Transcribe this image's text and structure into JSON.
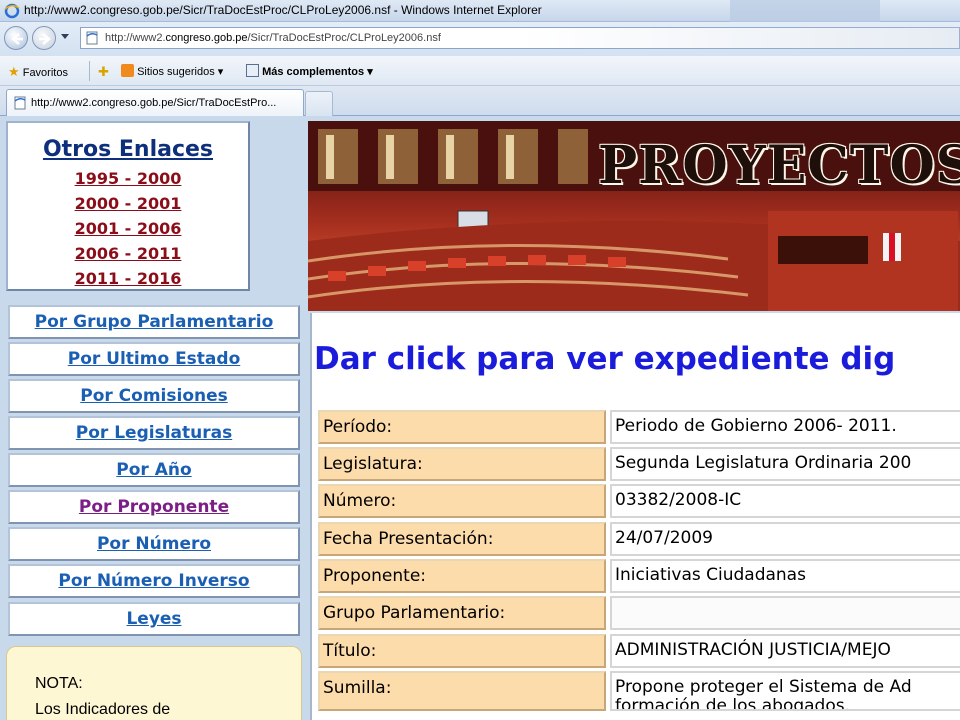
{
  "window": {
    "title": "http://www2.congreso.gob.pe/Sicr/TraDocEstProc/CLProLey2006.nsf - Windows Internet Explorer"
  },
  "address_bar": {
    "url_prefix": "http://www2.",
    "url_domain": "congreso.gob.pe",
    "url_path": "/Sicr/TraDocEstProc/CLProLey2006.nsf"
  },
  "favorites_bar": {
    "favoritos_label": "Favoritos",
    "sitios_label": "Sitios sugeridos",
    "complementos_label": "Más complementos"
  },
  "tabs": [
    {
      "label": "http://www2.congreso.gob.pe/Sicr/TraDocEstPro..."
    }
  ],
  "sidebar": {
    "otros_title": "Otros Enlaces",
    "periods": [
      "1995 - 2000",
      "2000 - 2001",
      "2001 - 2006",
      "2006 - 2011",
      "2011 - 2016"
    ],
    "nav_links": [
      "Por Grupo Parlamentario",
      "Por Ultimo Estado",
      "Por Comisiones",
      "Por Legislaturas",
      "Por Año",
      "Por Proponente",
      "Por Número",
      "Por Número Inverso",
      "Leyes"
    ],
    "nota_title": "NOTA:",
    "nota_text": "Los Indicadores de"
  },
  "banner": {
    "title": "PROYECTOS"
  },
  "main": {
    "heading": "Dar click para ver expediente dig",
    "fields": [
      {
        "label": "Período:",
        "value": "Periodo de Gobierno 2006- 2011."
      },
      {
        "label": "Legislatura:",
        "value": "Segunda Legislatura Ordinaria 200"
      },
      {
        "label": "Número:",
        "value": "03382/2008-IC"
      },
      {
        "label": "Fecha Presentación:",
        "value": "24/07/2009"
      },
      {
        "label": "Proponente:",
        "value": "Iniciativas Ciudadanas"
      },
      {
        "label": "Grupo Parlamentario:",
        "value": ""
      },
      {
        "label": "Título:",
        "value": "ADMINISTRACIÓN JUSTICIA/MEJO"
      },
      {
        "label": "Sumilla:",
        "value": "Propone proteger el Sistema de Ad",
        "value_line2": "formación de los abogados."
      }
    ]
  },
  "colors": {
    "link_blue": "#1a5fb4",
    "link_visited": "#7b1f86",
    "period_red": "#8b0d1a",
    "heading_blue": "#1b1bdc",
    "label_bg": "#fddcab"
  }
}
